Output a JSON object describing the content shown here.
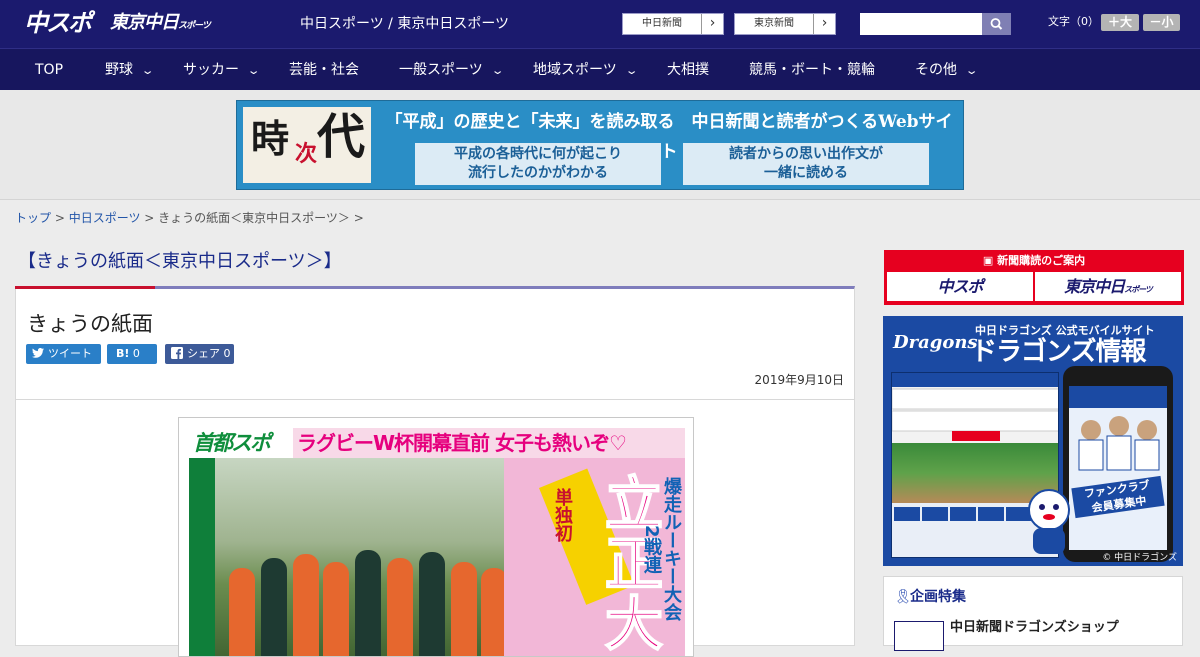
{
  "header": {
    "logo_chuspo": "中スポ",
    "logo_tokyo": "東京中日",
    "logo_tokyo_small": "スポーツ",
    "site_title": "中日スポーツ / 東京中日スポーツ",
    "paper_links": [
      "中日新聞",
      "東京新聞"
    ],
    "search_placeholder": "",
    "text_size_label": "文字（0）",
    "text_size_up": "＋大",
    "text_size_down": "－小"
  },
  "nav": {
    "items": [
      {
        "label": "TOP"
      },
      {
        "label": "野球"
      },
      {
        "label": "サッカー"
      },
      {
        "label": "芸能・社会"
      },
      {
        "label": "一般スポーツ"
      },
      {
        "label": "地域スポーツ"
      },
      {
        "label": "大相撲"
      },
      {
        "label": "競馬・ボート・競輪"
      },
      {
        "label": "その他"
      }
    ]
  },
  "banner": {
    "logo_chars": [
      "時",
      "次",
      "代"
    ],
    "headline": "「平成」の歴史と「未来」を読み取る　中日新聞と読者がつくるWebサイト",
    "box_left": "平成の各時代に何が起こり\n流行したのかがわかる",
    "box_right": "読者からの思い出作文が\n一緒に読める"
  },
  "breadcrumb": {
    "top": "トップ",
    "sep": " > ",
    "section": "中日スポーツ",
    "current": "きょうの紙面＜東京中日スポーツ＞",
    "trail_end": " >"
  },
  "main": {
    "page_heading": "【きょうの紙面＜東京中日スポーツ＞】",
    "article_title": "きょうの紙面",
    "share": {
      "tweet": "ツイート",
      "hatena_label": "B!",
      "hatena_count": "0",
      "fb_label": "シェア",
      "fb_count": "0"
    },
    "date": "2019年9月10日",
    "paper_image": {
      "masthead_a": "首都",
      "masthead_b": "スポ",
      "headline": "ラグビーW杯開幕直前 女子も熱いぞ♡",
      "big_text": "立正大",
      "side_text": "爆走ルーキー大会2戦連",
      "yellow_text": "単独初"
    }
  },
  "sidebar": {
    "subscribe_title": "新聞購読のご案内",
    "subscribe_logos": [
      "中スポ",
      "東京中日"
    ],
    "subscribe_logo_small": "スポーツ",
    "dragons_ad": {
      "logo": "Dragons",
      "subtitle": "中日ドラゴンズ 公式モバイルサイト",
      "title": "ドラゴンズ情報",
      "badge": "ファンクラブ\n会員募集中",
      "copyright": "© 中日ドラゴンズ"
    },
    "feature": {
      "title": "企画特集",
      "item": "中日新聞ドラゴンズショップ"
    }
  },
  "colors": {
    "header_bg": "#1b1a6e",
    "nav_bg": "#17165e",
    "heading_blue": "#1a2b8a",
    "accent_red": "#c8102e",
    "subscribe_red": "#e6001f"
  }
}
